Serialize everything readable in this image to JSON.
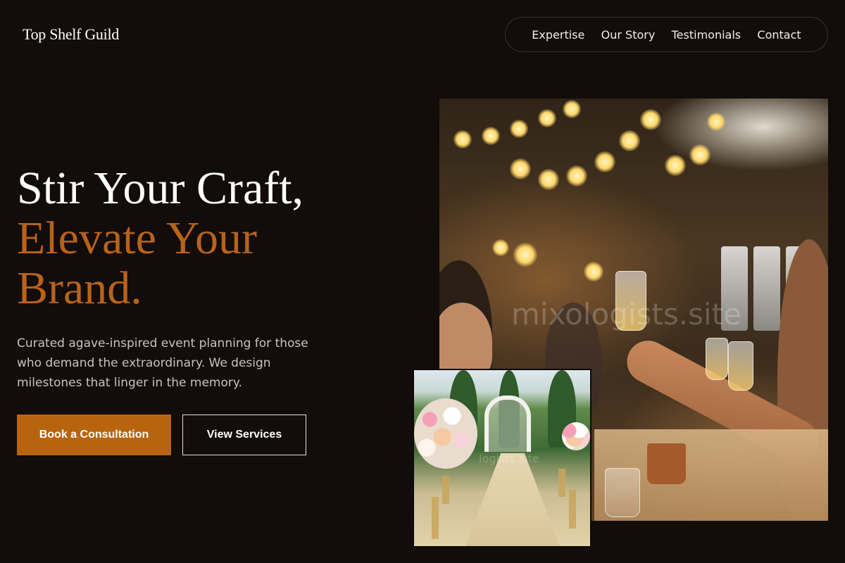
{
  "brand": {
    "name": "Top Shelf Guild"
  },
  "nav": {
    "items": [
      {
        "label": "Expertise"
      },
      {
        "label": "Our Story"
      },
      {
        "label": "Testimonials"
      },
      {
        "label": "Contact"
      }
    ]
  },
  "hero": {
    "title_line1": "Stir Your Craft,",
    "title_line2": "Elevate Your",
    "title_line3": "Brand.",
    "description": "Curated agave-inspired event planning for those who demand the extraordinary. We design milestones that linger in the memory.",
    "primary_button": "Book a Consultation",
    "secondary_button": "View Services"
  },
  "images": {
    "main_watermark": "mixologists.site",
    "small_watermark": "logists.site"
  },
  "colors": {
    "background": "#120c0b",
    "accent": "#b8621a",
    "primary_button": "#b8640f"
  }
}
